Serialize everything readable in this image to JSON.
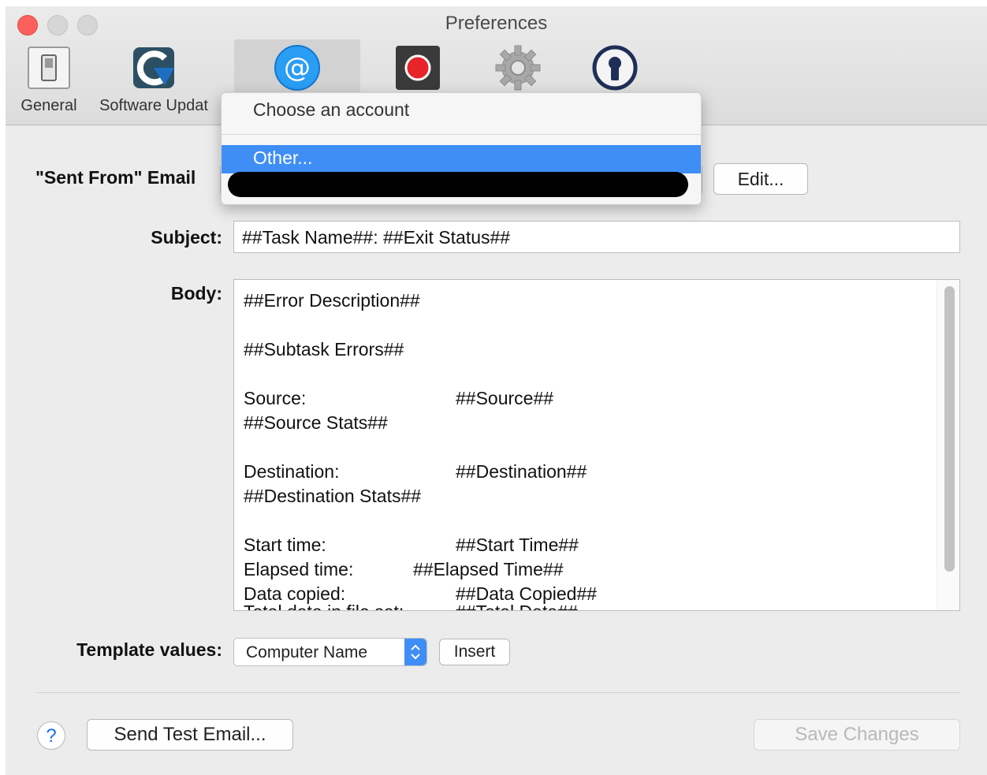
{
  "window": {
    "title": "Preferences"
  },
  "toolbar": {
    "items": [
      {
        "label": "General",
        "icon": "switch-icon"
      },
      {
        "label": "Software Updat",
        "icon": "software-update-icon"
      },
      {
        "label": "",
        "icon": "email-at-icon"
      },
      {
        "label": "",
        "icon": "record-icon"
      },
      {
        "label": "",
        "icon": "gear-icon"
      },
      {
        "label": "",
        "icon": "keyhole-icon"
      }
    ]
  },
  "email": {
    "sent_from_label": "\"Sent From\" Email",
    "edit_button": "Edit...",
    "account_menu": {
      "header": "Choose an account",
      "selected_item": "Other..."
    }
  },
  "subject": {
    "label": "Subject:",
    "value": "##Task Name##: ##Exit Status##"
  },
  "body": {
    "label": "Body:",
    "lines": [
      {
        "text": "##Error Description##"
      },
      {
        "text": "##Subtask Errors##"
      },
      {
        "text": "Source:",
        "value": "##Source##"
      },
      {
        "text": "##Source Stats##"
      },
      {
        "text": "Destination:",
        "value": "##Destination##"
      },
      {
        "text": "##Destination Stats##"
      },
      {
        "text": "Start time:",
        "value": "##Start Time##"
      },
      {
        "text": "Elapsed time:",
        "value": "##Elapsed Time##"
      },
      {
        "text": "Data copied:",
        "value": "##Data Copied##"
      },
      {
        "text": "Total data in file set:",
        "value": "##Total Data##"
      }
    ]
  },
  "template": {
    "label": "Template values:",
    "selected": "Computer Name",
    "insert_button": "Insert"
  },
  "footer": {
    "help": "?",
    "send_test": "Send Test Email...",
    "save": "Save Changes"
  },
  "colors": {
    "accent": "#3f8ef5",
    "close": "#fc605c",
    "window_bg": "#ececec"
  }
}
